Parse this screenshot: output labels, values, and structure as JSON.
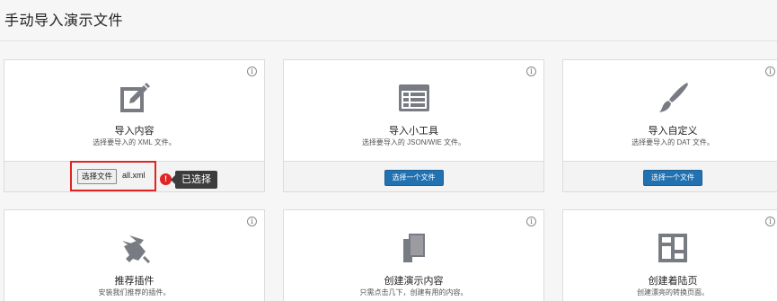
{
  "page": {
    "title": "手动导入演示文件"
  },
  "cards": [
    {
      "title": "导入内容",
      "desc": "选择要导入的 XML 文件。",
      "icon": "edit-document-icon",
      "file_input": {
        "button_label": "选择文件",
        "filename": "all.xml"
      }
    },
    {
      "title": "导入小工具",
      "desc": "选择要导入的 JSON/WIE 文件。",
      "icon": "widgets-icon",
      "button_label": "选择一个文件"
    },
    {
      "title": "导入自定义",
      "desc": "选择要导入的 DAT 文件。",
      "icon": "paintbrush-icon",
      "button_label": "选择一个文件"
    },
    {
      "title": "推荐插件",
      "desc": "安装我们推荐的插件。",
      "icon": "plugin-icon"
    },
    {
      "title": "创建演示内容",
      "desc": "只需点击几下，创建有用的内容。",
      "icon": "documents-icon"
    },
    {
      "title": "创建着陆页",
      "desc": "创建漂亮的转换页面。",
      "icon": "layout-icon"
    }
  ],
  "info_icon": "i",
  "annotation": {
    "badge": "!",
    "tooltip": "已选择"
  },
  "colors": {
    "primary_button": "#2271b1",
    "highlight": "#e02424",
    "icon_gray": "#787c82"
  }
}
